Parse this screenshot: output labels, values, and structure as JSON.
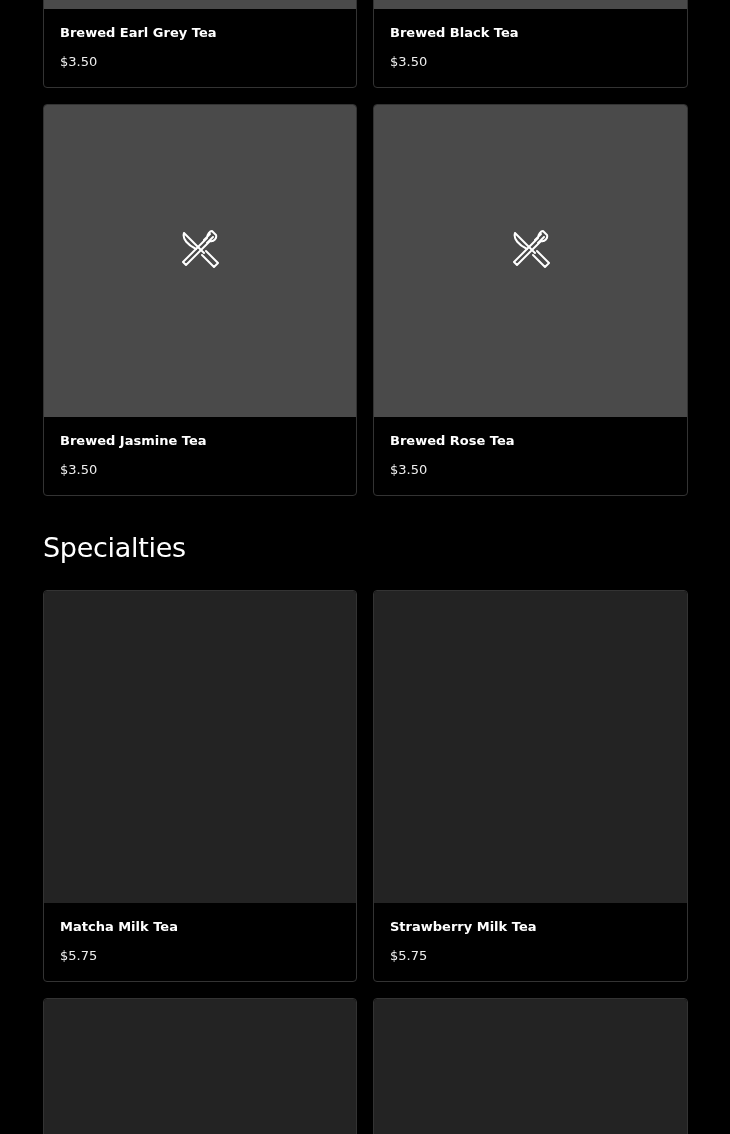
{
  "sections": [
    {
      "items": [
        {
          "name": "Brewed Earl Grey Tea",
          "price": "$3.50",
          "kind": "grey"
        },
        {
          "name": "Brewed Black Tea",
          "price": "$3.50",
          "kind": "grey"
        },
        {
          "name": "Brewed Jasmine Tea",
          "price": "$3.50",
          "kind": "placeholder"
        },
        {
          "name": "Brewed Rose Tea",
          "price": "$3.50",
          "kind": "placeholder"
        }
      ]
    },
    {
      "title": "Specialties",
      "items": [
        {
          "name": "Matcha Milk Tea",
          "price": "$5.75",
          "kind": "blank"
        },
        {
          "name": "Strawberry Milk Tea",
          "price": "$5.75",
          "kind": "blank"
        },
        {
          "kind": "blank"
        },
        {
          "kind": "blank"
        }
      ]
    }
  ]
}
